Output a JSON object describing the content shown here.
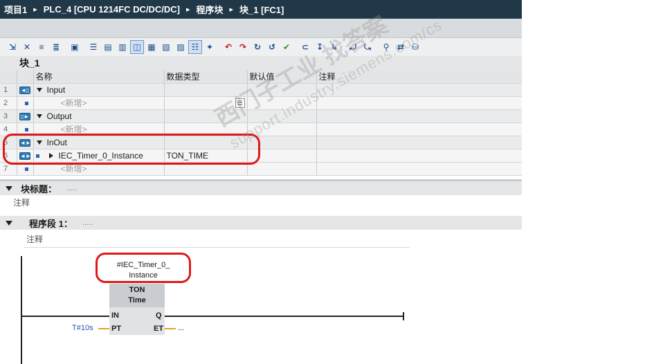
{
  "breadcrumb": {
    "items": [
      "项目1",
      "PLC_4 [CPU 1214FC DC/DC/DC]",
      "程序块",
      "块_1 [FC1]"
    ],
    "separator": "▸"
  },
  "toolbar": {
    "icons": [
      "insert-row-icon",
      "delete-row-icon",
      "insert-network-icon",
      "delete-network-icon",
      "goto-icon",
      "open-all-networks-icon",
      "close-all-networks-icon",
      "show-comments-icon",
      "favorites-icon",
      "absolute-operands-icon",
      "symbolic-operands-icon",
      "tag-info-icon",
      "network-comment-icon",
      "call-icon",
      "compare-icon",
      "monitor-icon",
      "force-icon",
      "modify-icon",
      "status-icon",
      "breakpoint-icon",
      "step-icon",
      "step-out-icon",
      "first-error-icon",
      "next-error-icon",
      "reference-icon",
      "crossref-icon",
      "download-icon"
    ]
  },
  "block": {
    "name": "块_1"
  },
  "interface": {
    "headers": {
      "name": "名称",
      "datatype": "数据类型",
      "default": "默认值",
      "comment": "注释"
    },
    "rows": [
      {
        "num": "1",
        "kind": "section",
        "name": "Input",
        "datatype": ""
      },
      {
        "num": "2",
        "kind": "add",
        "name": "<新增>",
        "datatype": ""
      },
      {
        "num": "3",
        "kind": "section",
        "name": "Output",
        "datatype": ""
      },
      {
        "num": "4",
        "kind": "add",
        "name": "<新增>",
        "datatype": ""
      },
      {
        "num": "5",
        "kind": "section",
        "name": "InOut",
        "datatype": ""
      },
      {
        "num": "6",
        "kind": "member",
        "name": "IEC_Timer_0_Instance",
        "datatype": "TON_TIME"
      },
      {
        "num": "7",
        "kind": "add",
        "name": "<新增>",
        "datatype": ""
      }
    ]
  },
  "block_title": {
    "label": "块标题：",
    "dots": ".....",
    "comment": "注释"
  },
  "network": {
    "label": "程序段 1：",
    "dots": ".....",
    "comment": "注释"
  },
  "ladder": {
    "instance_line1": "#IEC_Timer_0_",
    "instance_line2": "Instance",
    "box_type": "TON",
    "box_subtype": "Time",
    "pin_in": "IN",
    "pin_pt": "PT",
    "pin_q": "Q",
    "pin_et": "ET",
    "pt_value": "T#10s",
    "et_value": "..."
  },
  "watermark": {
    "line1": "西门子工业  找答案",
    "line2": "support.industry.siemens.com/cs"
  },
  "colors": {
    "titlebar": "#203848",
    "annotation": "#e01818",
    "icon_blue": "#2f7ab3",
    "pt_value": "#2a4fb8",
    "param_wire": "#e6a21a"
  }
}
